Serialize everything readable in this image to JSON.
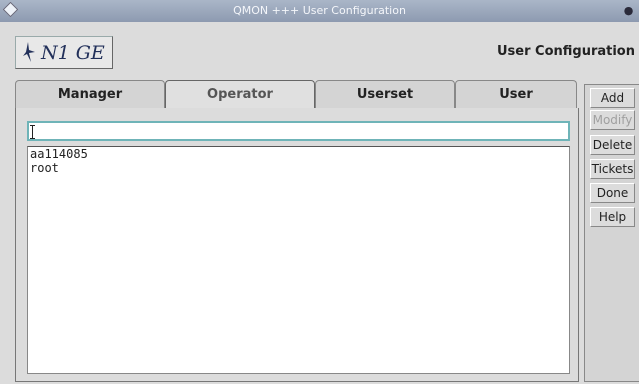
{
  "window": {
    "title": "QMON  +++  User Configuration"
  },
  "header": {
    "logo_text": "N1 GE",
    "title": "User Configuration"
  },
  "tabs": [
    {
      "label": "Manager",
      "active": false
    },
    {
      "label": "Operator",
      "active": true
    },
    {
      "label": "Userset",
      "active": false
    },
    {
      "label": "User",
      "active": false
    }
  ],
  "input": {
    "value": ""
  },
  "list": {
    "items": [
      "aa114085",
      "root"
    ]
  },
  "buttons": {
    "add": "Add",
    "modify": "Modify",
    "delete": "Delete",
    "tickets": "Tickets",
    "done": "Done",
    "help": "Help"
  }
}
